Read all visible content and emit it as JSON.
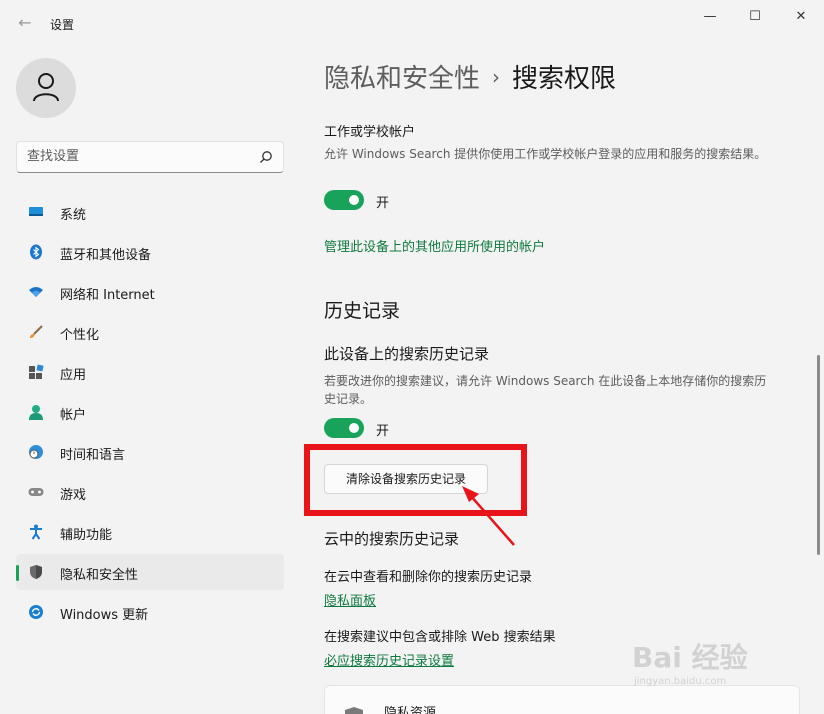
{
  "window": {
    "app_title": "设置",
    "controls": {
      "minimize": "—",
      "maximize": "☐",
      "close": "✕"
    }
  },
  "user": {
    "name": "████████████████████",
    "email": "██████████████████"
  },
  "search": {
    "placeholder": "查找设置"
  },
  "sidebar": {
    "items": [
      {
        "label": "系统",
        "icon": "system-icon"
      },
      {
        "label": "蓝牙和其他设备",
        "icon": "bluetooth-icon"
      },
      {
        "label": "网络和 Internet",
        "icon": "wifi-icon"
      },
      {
        "label": "个性化",
        "icon": "brush-icon"
      },
      {
        "label": "应用",
        "icon": "apps-icon"
      },
      {
        "label": "帐户",
        "icon": "account-icon"
      },
      {
        "label": "时间和语言",
        "icon": "globe-clock-icon"
      },
      {
        "label": "游戏",
        "icon": "gamepad-icon"
      },
      {
        "label": "辅助功能",
        "icon": "accessibility-icon"
      },
      {
        "label": "隐私和安全性",
        "icon": "shield-icon",
        "active": true
      },
      {
        "label": "Windows 更新",
        "icon": "update-icon"
      }
    ]
  },
  "breadcrumb": {
    "parent": "隐私和安全性",
    "separator": "›",
    "current": "搜索权限"
  },
  "main": {
    "work_account": {
      "label": "工作或学校帐户",
      "description": "允许 Windows Search 提供你使用工作或学校帐户登录的应用和服务的搜索结果。",
      "toggle_state": "开",
      "manage_link": "管理此设备上的其他应用所使用的帐户"
    },
    "history": {
      "heading": "历史记录",
      "device_history": {
        "label": "此设备上的搜索历史记录",
        "description": "若要改进你的搜索建议，请允许 Windows Search 在此设备上本地存储你的搜索历史记录。",
        "toggle_state": "开",
        "clear_button": "清除设备搜索历史记录"
      },
      "cloud_history": {
        "label": "云中的搜索历史记录",
        "view_delete_text": "在云中查看和删除你的搜索历史记录",
        "privacy_link": "隐私面板",
        "web_results_text": "在搜索建议中包含或排除 Web 搜索结果",
        "bing_link": "必应搜索历史记录设置"
      }
    },
    "privacy_resources": {
      "label": "隐私资源"
    }
  },
  "watermark": {
    "main": "Bai 经验",
    "sub": "jingyan.baidu.com"
  },
  "colors": {
    "accent": "#19a35a",
    "link": "#0f7a3f",
    "highlight": "#e8141a"
  }
}
